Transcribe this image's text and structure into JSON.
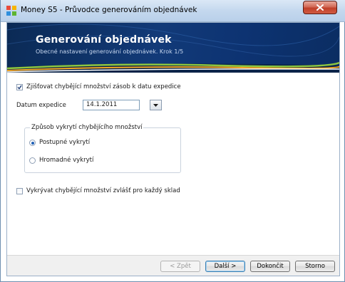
{
  "window": {
    "title": "Money S5 - Průvodce generováním objednávek",
    "close_icon": "close-icon"
  },
  "banner": {
    "title": "Generování objednávek",
    "subtitle": "Obecné nastavení generování objednávek. Krok 1/5"
  },
  "form": {
    "check_missing": {
      "label": "Zjišťovat chybějící množství zásob k datu expedice",
      "checked": true
    },
    "date": {
      "label": "Datum expedice",
      "value": "14.1.2011"
    },
    "coverage_group": {
      "legend": "Způsob vykrytí chybějícího množství",
      "options": [
        {
          "label": "Postupné vykrytí",
          "selected": true
        },
        {
          "label": "Hromadné vykrytí",
          "selected": false
        }
      ]
    },
    "per_warehouse": {
      "label": "Vykrývat chybějící množství zvlášť pro každý sklad",
      "checked": false
    }
  },
  "buttons": {
    "back": "< Zpět",
    "next": "Další >",
    "finish": "Dokončit",
    "cancel": "Storno"
  },
  "colors": {
    "banner_dark": "#0b2a55",
    "accent_green": "#8dc63f",
    "accent_orange": "#f5a623",
    "close_red": "#c0402a"
  }
}
